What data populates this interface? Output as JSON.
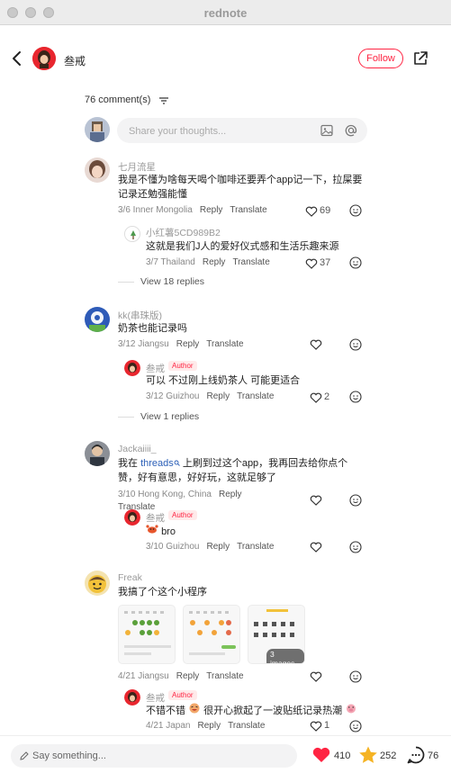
{
  "window": {
    "title": "rednote"
  },
  "header": {
    "author": "叁戒",
    "follow_label": "Follow"
  },
  "comments_header": {
    "count_label": "76 comment(s)"
  },
  "composer": {
    "placeholder": "Share your thoughts..."
  },
  "comments": [
    {
      "user": "七月流星",
      "text": "我是不懂为啥每天喝个咖啡还要弄个app记一下，拉屎要记录还勉强能懂",
      "date_loc": "3/6 Inner Mongolia",
      "reply": "Reply",
      "translate": "Translate",
      "likes": "69",
      "replies": [
        {
          "user": "小红薯5CD989B2",
          "text": "这就是我们J人的爱好仪式感和生活乐趣来源",
          "date_loc": "3/7 Thailand",
          "reply": "Reply",
          "translate": "Translate",
          "likes": "37"
        }
      ],
      "view_more": "View 18 replies"
    },
    {
      "user": "kk(串珠版)",
      "text": "奶茶也能记录吗",
      "date_loc": "3/12 Jiangsu",
      "reply": "Reply",
      "translate": "Translate",
      "likes": "",
      "replies": [
        {
          "user": "叁戒",
          "badge": "Author",
          "text": "可以 不过刚上线奶茶人 可能更适合",
          "date_loc": "3/12 Guizhou",
          "reply": "Reply",
          "translate": "Translate",
          "likes": "2"
        }
      ],
      "view_more": "View 1 replies"
    },
    {
      "user": "Jackaiiii_",
      "text_before": "我在 ",
      "text_link": "threads",
      "text_after": " 上刷到过这个app，我再回去给你点个赞，好有意思，好好玩，这就足够了",
      "date_loc": "3/10 Hong Kong, China",
      "reply": "Reply",
      "translate": "Translate",
      "likes": "",
      "replies": [
        {
          "user": "叁戒",
          "badge": "Author",
          "text": "bro",
          "date_loc": "3/10 Guizhou",
          "reply": "Reply",
          "translate": "Translate",
          "likes": ""
        }
      ]
    },
    {
      "user": "Freak",
      "text": "我搞了个这个小程序",
      "images_label": "3 images",
      "date_loc": "4/21 Jiangsu",
      "reply": "Reply",
      "translate": "Translate",
      "likes": "",
      "replies": [
        {
          "user": "叁戒",
          "badge": "Author",
          "text_a": "不错不错",
          "text_b": "很开心掀起了一波贴纸记录热潮",
          "date_loc": "4/21 Japan",
          "reply": "Reply",
          "translate": "Translate",
          "likes": "1"
        }
      ]
    }
  ],
  "bottom_bar": {
    "say_placeholder": "Say something...",
    "likes": "410",
    "stars": "252",
    "comments": "76"
  },
  "colors": {
    "accent": "#ff2442",
    "link": "#2b5fb7",
    "star": "#f5b323"
  }
}
